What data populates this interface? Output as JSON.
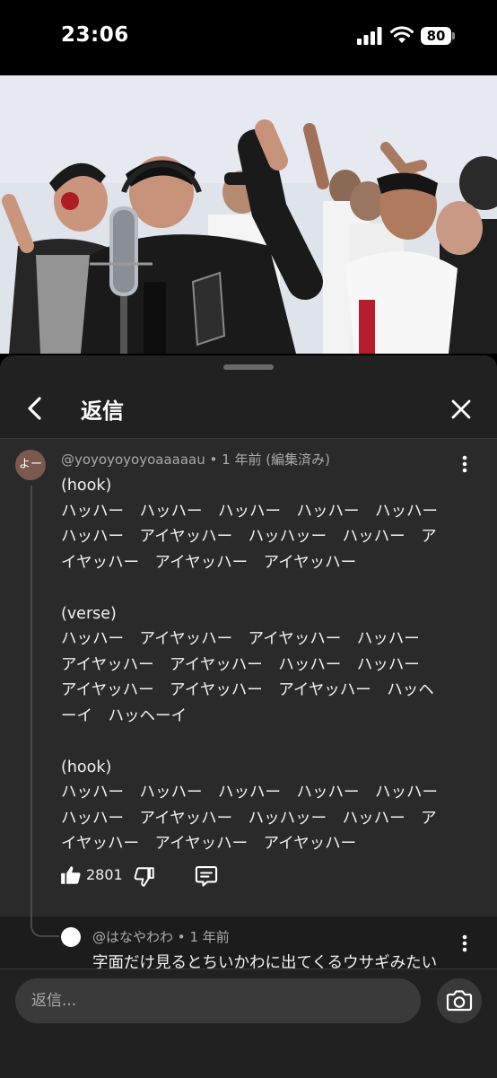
{
  "status_bar": {
    "time": "23:06",
    "battery": "80"
  },
  "header": {
    "title": "返信"
  },
  "comment": {
    "avatar_text": "よー",
    "author": "@yoyoyoyoyoaaaaau",
    "separator": "•",
    "time": "1 年前 (編集済み)",
    "text": "(hook)\nハッハー　ハッハー　ハッハー　ハッハー　ハッハー\nハッハー　アイヤッハー　ハッハッー　ハッハー　ア\nイヤッハー　アイヤッハー　アイヤッハー\n\n(verse)\nハッハー　アイヤッハー　アイヤッハー　ハッハー\nアイヤッハー　アイヤッハー　ハッハー　ハッハー\nアイヤッハー　アイヤッハー　アイヤッハー　ハッヘ\nーイ　ハッヘーイ\n\n(hook)\nハッハー　ハッハー　ハッハー　ハッハー　ハッハー\nハッハー　アイヤッハー　ハッハッー　ハッハー　ア\nイヤッハー　アイヤッハー　アイヤッハー",
    "likes": "2801"
  },
  "reply": {
    "author": "@はなやわわ",
    "separator": "•",
    "time": "1 年前",
    "text": "字面だけ見るとちいかわに出てくるウサギみたい"
  },
  "input": {
    "placeholder": "返信..."
  },
  "icons": {
    "back": "chevron-left-icon",
    "close": "close-icon",
    "more": "more-vert-icon",
    "like": "thumb-up-icon",
    "dislike": "thumb-down-icon",
    "reply": "comment-icon",
    "camera": "camera-icon"
  },
  "colors": {
    "background": "#212121",
    "comment_bg": "#2a2a2a",
    "avatar": "#7a5a4e"
  }
}
